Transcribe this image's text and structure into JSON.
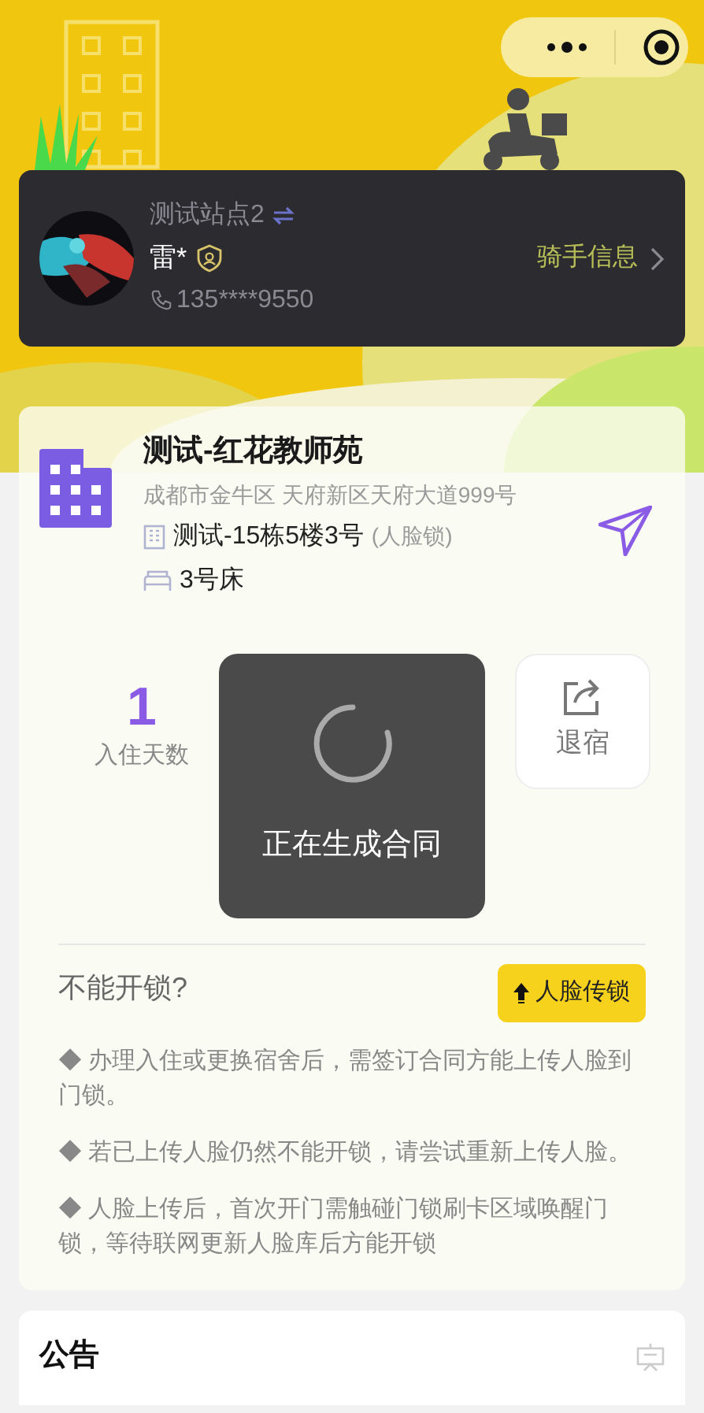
{
  "rider": {
    "station": "测试站点2",
    "name": "雷*",
    "phone": "135****9550",
    "link": "骑手信息"
  },
  "dorm": {
    "title": "测试-红花教师苑",
    "address": "成都市金牛区 天府新区天府大道999号",
    "room": "测试-15栋5楼3号",
    "lock_type": "(人脸锁)",
    "bed": "3号床"
  },
  "stats": {
    "days_value": "1",
    "days_label": "入住天数",
    "checkout_label": "退宿"
  },
  "toast": {
    "text": "正在生成合同"
  },
  "unlock": {
    "title": "不能开锁?",
    "button": "人脸传锁",
    "tips": [
      "◆ 办理入住或更换宿舍后，需签订合同方能上传人脸到门锁。",
      "◆ 若已上传人脸仍然不能开锁，请尝试重新上传人脸。",
      "◆ 人脸上传后，首次开门需触碰门锁刷卡区域唤醒门锁，等待联网更新人脸库后方能开锁"
    ]
  },
  "notice": {
    "title": "公告"
  }
}
